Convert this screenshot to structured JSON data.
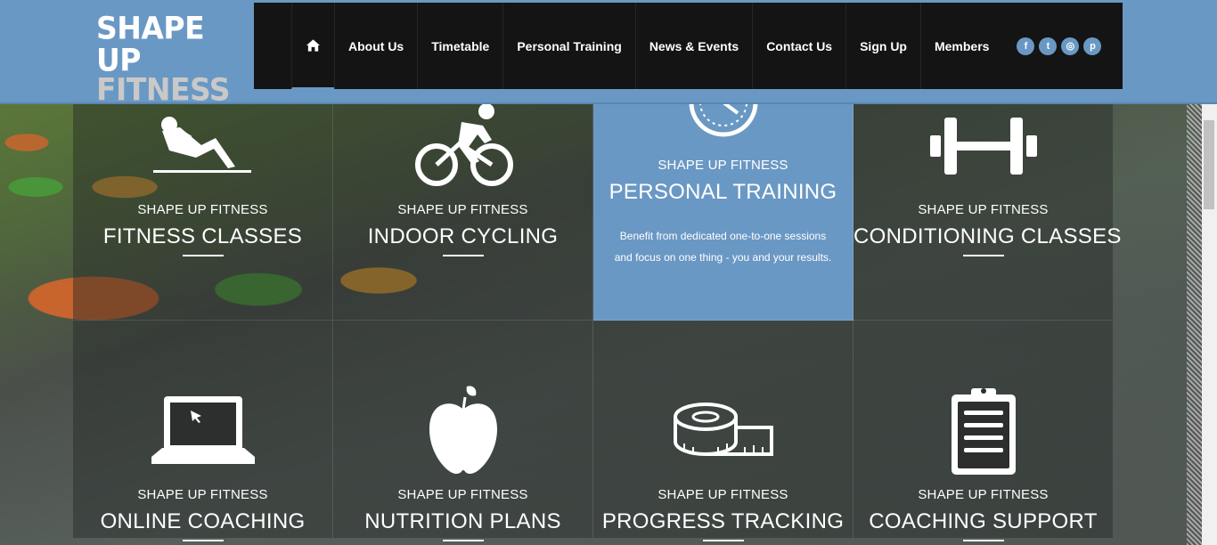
{
  "logo": {
    "line1": "SHAPE UP",
    "line2": "FITNESS"
  },
  "nav": {
    "home_icon": "home-icon",
    "items": [
      "About Us",
      "Timetable",
      "Personal Training",
      "News & Events",
      "Contact Us",
      "Sign Up",
      "Members"
    ],
    "social": [
      {
        "icon": "facebook-icon",
        "glyph": "f"
      },
      {
        "icon": "twitter-icon",
        "glyph": "t"
      },
      {
        "icon": "instagram-icon",
        "glyph": "◎"
      },
      {
        "icon": "pinterest-icon",
        "glyph": "p"
      }
    ]
  },
  "tiles": [
    {
      "icon": "situp-icon",
      "kicker": "SHAPE UP FITNESS",
      "title": "FITNESS CLASSES"
    },
    {
      "icon": "cycling-icon",
      "kicker": "SHAPE UP FITNESS",
      "title": "INDOOR CYCLING"
    },
    {
      "icon": "stopwatch-icon",
      "kicker": "SHAPE UP FITNESS",
      "title": "PERSONAL TRAINING",
      "desc_line1": "Benefit from dedicated one-to-one sessions",
      "desc_line2": "and focus on one thing - you and your results."
    },
    {
      "icon": "dumbbell-icon",
      "kicker": "SHAPE UP FITNESS",
      "title": "CONDITIONING CLASSES"
    },
    {
      "icon": "laptop-icon",
      "kicker": "SHAPE UP FITNESS",
      "title": "ONLINE COACHING"
    },
    {
      "icon": "apple-icon",
      "kicker": "SHAPE UP FITNESS",
      "title": "NUTRITION PLANS"
    },
    {
      "icon": "tape-measure-icon",
      "kicker": "SHAPE UP FITNESS",
      "title": "PROGRESS TRACKING"
    },
    {
      "icon": "clipboard-icon",
      "kicker": "SHAPE UP FITNESS",
      "title": "COACHING SUPPORT"
    }
  ],
  "colors": {
    "brand": "#6a98c4",
    "nav_bg": "#141414"
  }
}
